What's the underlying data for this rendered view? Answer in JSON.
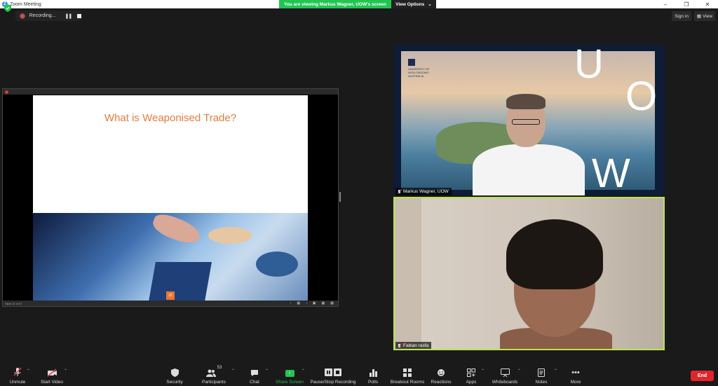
{
  "window": {
    "title": "Zoom Meeting"
  },
  "banner": {
    "message": "You are viewing Markus Wagner, UOW's screen",
    "options_label": "View Options"
  },
  "recording": {
    "label": "Recording..."
  },
  "topbar": {
    "signin_label": "Sign in",
    "view_label": "View"
  },
  "shared_screen": {
    "slide_title": "What is Weaponised Trade?",
    "slide_number": "22",
    "status_text": "Slide 22 of 37"
  },
  "participants_tiles": [
    {
      "name": "Markus Wagner, UOW",
      "muted": true,
      "logo_text": "UNIVERSITY OF WOLLONGONG AUSTRALIA",
      "bg_letters": [
        "U",
        "O",
        "W"
      ]
    },
    {
      "name": "Fabian rasfa",
      "muted": true,
      "active_speaker": true
    }
  ],
  "toolbar": {
    "unmute": "Unmute",
    "start_video": "Start Video",
    "security": "Security",
    "participants": "Participants",
    "participants_count": "53",
    "chat": "Chat",
    "share_screen": "Share Screen",
    "pause_recording": "Pause/Stop Recording",
    "polls": "Polls",
    "breakout_rooms": "Breakout Rooms",
    "reactions": "Reactions",
    "apps": "Apps",
    "whiteboards": "Whiteboards",
    "notes": "Notes",
    "more": "More",
    "end": "End"
  },
  "colors": {
    "share_green": "#23c552",
    "end_red": "#e0262b",
    "active_speaker_border": "#b9e64a",
    "slide_title_orange": "#e87c3a"
  }
}
